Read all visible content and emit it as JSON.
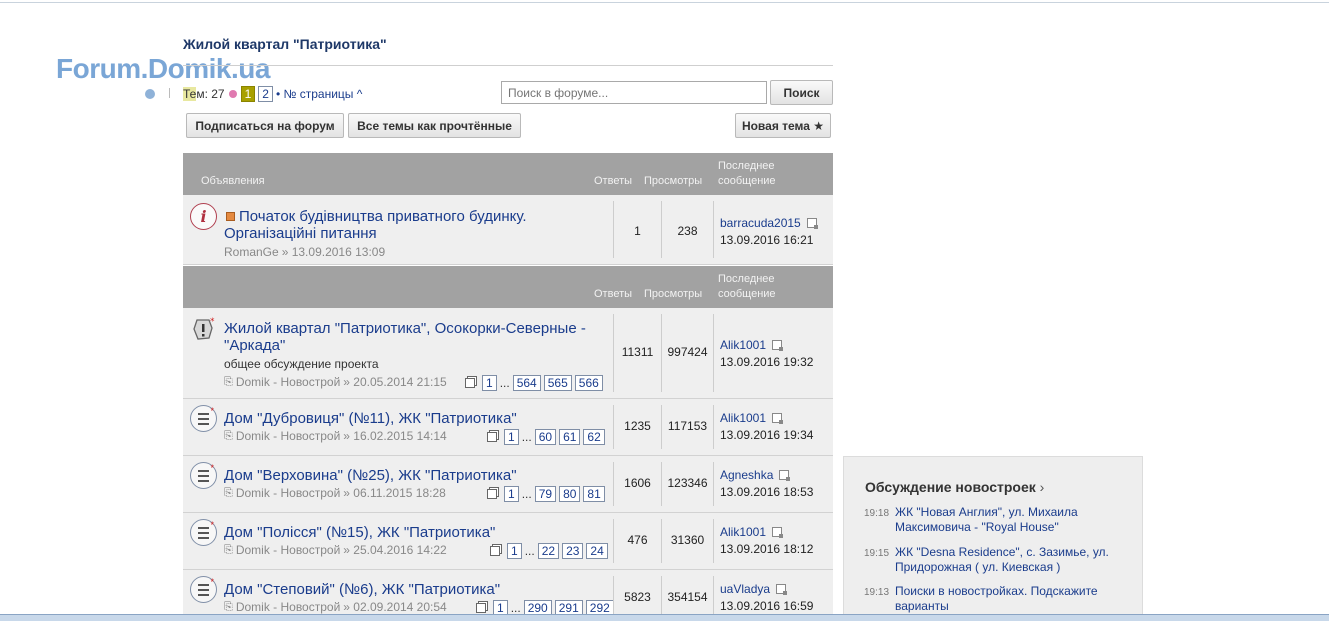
{
  "logo": "Forum.Domik.ua",
  "forum_title": "Жилой квартал \"Патриотика\"",
  "topics": {
    "label_prefix": "Те",
    "label_rest": "м: 27",
    "current_page": "1",
    "page2": "2",
    "page_select": "• № страницы ^"
  },
  "search": {
    "placeholder": "Поиск в форуме...",
    "button": "Поиск"
  },
  "buttons": {
    "subscribe": "Подписаться на форум",
    "mark_read": "Все темы как прочтённые",
    "new_topic": "Новая тема ★"
  },
  "announce_header": {
    "section": "Объявления",
    "replies": "Ответы",
    "views": "Просмотры",
    "last_post_1": "Последнее",
    "last_post_2": "сообщение"
  },
  "announcement": {
    "title_1": "Початок будівництва приватного будинку.",
    "title_2": "Організаційні питання",
    "author": "RomanGe",
    "date": "» 13.09.2016 13:09",
    "replies": "1",
    "views": "238",
    "last_user": "barracuda2015",
    "last_date": "13.09.2016 16:21"
  },
  "topics_header": {
    "replies": "Ответы",
    "views": "Просмотры",
    "last_post_1": "Последнее",
    "last_post_2": "сообщение"
  },
  "topic_rows": [
    {
      "title_1": "Жилой квартал \"Патриотика\", Осокорки-Северные -",
      "title_2": "\"Аркада\"",
      "desc": "общее обсуждение проекта",
      "author": "Domik - Новострой",
      "date": "» 20.05.2014 21:15",
      "pages": [
        "1",
        "...",
        "564",
        "565",
        "566"
      ],
      "replies": "11311",
      "views": "997424",
      "last_user": "Alik1001",
      "last_date": "13.09.2016 19:32"
    },
    {
      "title_1": "Дом \"Дубровиця\" (№11), ЖК \"Патриотика\"",
      "author": "Domik - Новострой",
      "date": "» 16.02.2015 14:14",
      "pages": [
        "1",
        "...",
        "60",
        "61",
        "62"
      ],
      "replies": "1235",
      "views": "117153",
      "last_user": "Alik1001",
      "last_date": "13.09.2016 19:34"
    },
    {
      "title_1": "Дом \"Верховина\" (№25), ЖК \"Патриотика\"",
      "author": "Domik - Новострой",
      "date": "» 06.11.2015 18:28",
      "pages": [
        "1",
        "...",
        "79",
        "80",
        "81"
      ],
      "replies": "1606",
      "views": "123346",
      "last_user": "Agneshka",
      "last_date": "13.09.2016 18:53"
    },
    {
      "title_1": "Дом \"Полісся\" (№15), ЖК \"Патриотика\"",
      "author": "Domik - Новострой",
      "date": "» 25.04.2016 14:22",
      "pages": [
        "1",
        "...",
        "22",
        "23",
        "24"
      ],
      "replies": "476",
      "views": "31360",
      "last_user": "Alik1001",
      "last_date": "13.09.2016 18:12"
    },
    {
      "title_1": "Дом \"Степовий\" (№6), ЖК \"Патриотика\"",
      "author": "Domik - Новострой",
      "date": "» 02.09.2014 20:54",
      "pages": [
        "1",
        "...",
        "290",
        "291",
        "292"
      ],
      "replies": "5823",
      "views": "354154",
      "last_user": "uaVladya",
      "last_date": "13.09.2016 16:59"
    }
  ],
  "sidebar": {
    "title": "Обсуждение новостроек",
    "items": [
      {
        "time": "19:18",
        "text": "ЖК \"Новая Англия\", ул. Михаила Максимовича - \"Royal House\""
      },
      {
        "time": "19:15",
        "text": "ЖК \"Desna Residence\", с. Зазимье, ул. Придорожная ( ул. Киевская )"
      },
      {
        "time": "19:13",
        "text": "Поиски в новостройках. Подскажите варианты"
      }
    ]
  }
}
